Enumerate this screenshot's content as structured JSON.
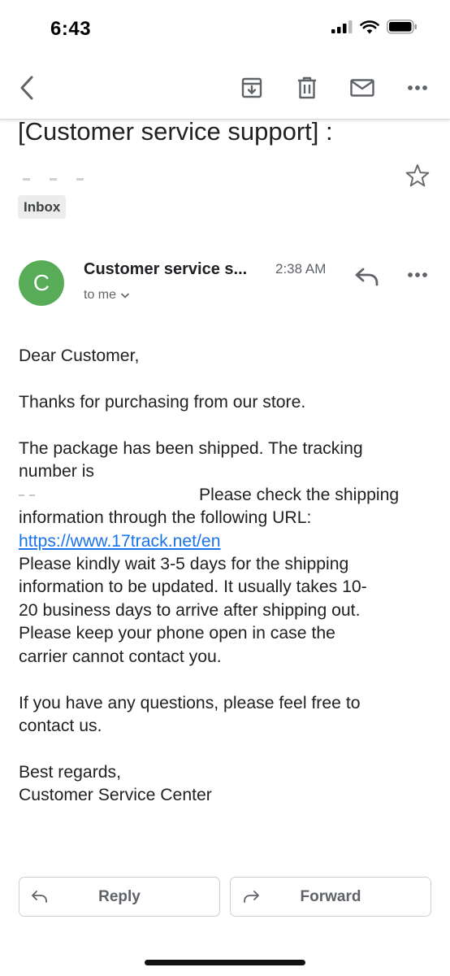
{
  "status_bar": {
    "time": "6:43"
  },
  "toolbar": {
    "back": "back-arrow-icon",
    "archive": "archive-icon",
    "delete": "trash-icon",
    "mark_unread": "mail-icon",
    "more": "more-horizontal-icon"
  },
  "email": {
    "subject": "[Customer service support] :",
    "label": "Inbox",
    "sender_initial": "C",
    "sender_name": "Customer service s...",
    "time": "2:38 AM",
    "recipient": "to me",
    "body": {
      "greeting": "Dear Customer,",
      "thanks": "Thanks for purchasing from our store.",
      "line1": "The package has been shipped. The tracking",
      "line2": "number is",
      "line3": "Please check the shipping",
      "line4": "information through the following URL:",
      "link": "https://www.17track.net/en",
      "line5": "Please kindly wait 3-5 days for the shipping",
      "line6": "information to be updated. It usually takes 10-",
      "line7": "20 business days to arrive after shipping out.",
      "line8": "Please keep your phone open in case the",
      "line9": "carrier cannot contact you.",
      "line10": "If you have any questions, please feel free to",
      "line11": "contact us.",
      "closing": "Best regards,",
      "signature": "Customer Service Center"
    }
  },
  "actions": {
    "reply_label": "Reply",
    "forward_label": "Forward"
  },
  "colors": {
    "accent_link": "#1a73e8",
    "avatar": "#58ab57",
    "text": "#202124",
    "muted": "#5f6368"
  }
}
